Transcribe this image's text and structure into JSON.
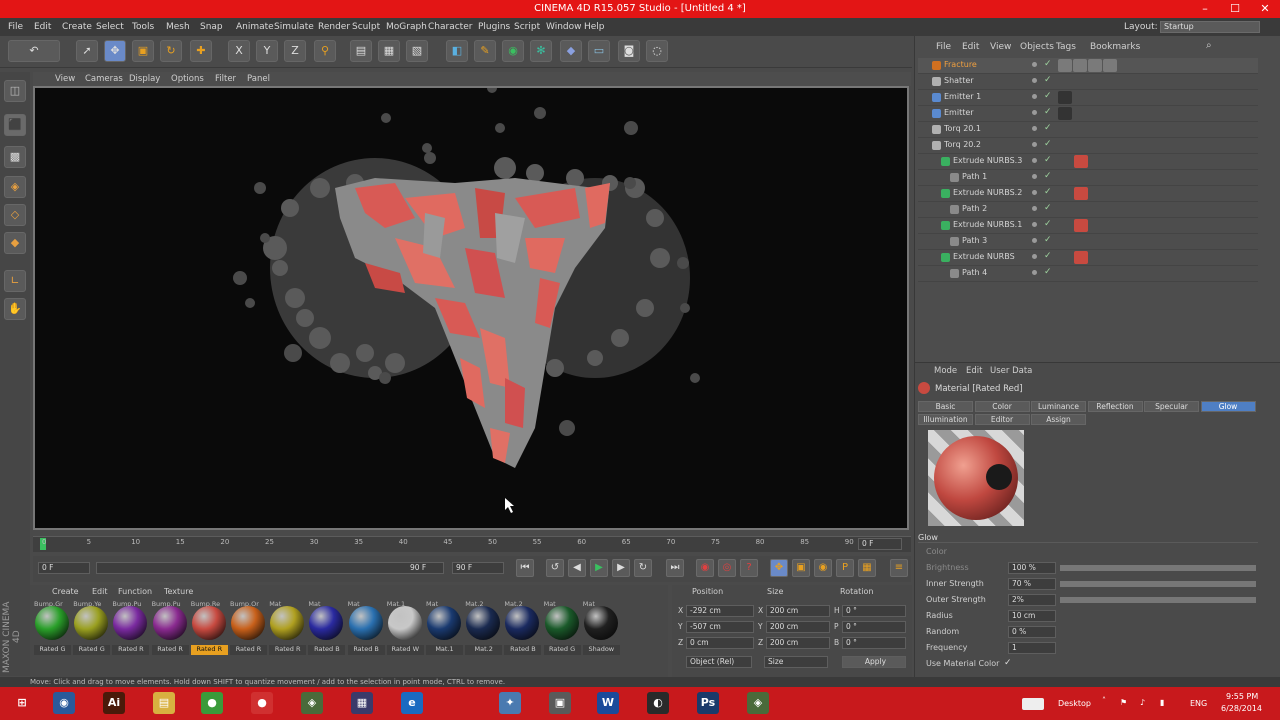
{
  "window": {
    "title": "CINEMA 4D R15.057 Studio - [Untitled 4 *]",
    "minimize_label": "–",
    "maximize_label": "☐",
    "close_label": "✕"
  },
  "menu": [
    "File",
    "Edit",
    "Create",
    "Select",
    "Tools",
    "Mesh",
    "Snap",
    "Animate",
    "Simulate",
    "Render",
    "Sculpt",
    "MoGraph",
    "Character",
    "Plugins",
    "Script",
    "Window",
    "Help"
  ],
  "layout": {
    "label": "Layout:",
    "value": "Startup"
  },
  "viewport": {
    "menu": [
      "View",
      "Cameras",
      "Display",
      "Options",
      "Filter",
      "Panel"
    ]
  },
  "timeline": {
    "ticks": [
      "0",
      "5",
      "10",
      "15",
      "20",
      "25",
      "30",
      "35",
      "40",
      "45",
      "50",
      "55",
      "60",
      "65",
      "70",
      "75",
      "80",
      "85",
      "90"
    ],
    "end_frame": "0 F",
    "start_field": "0 F",
    "range_end": "90 F",
    "max_field": "90 F"
  },
  "material_manager": {
    "menu": [
      "Create",
      "Edit",
      "Function",
      "Texture"
    ],
    "materials": [
      {
        "top": "Bump.Gr",
        "name": "Rated G",
        "color": "#2aa02a"
      },
      {
        "top": "Bump.Ye",
        "name": "Rated G",
        "color": "#9aa020"
      },
      {
        "top": "Bump.Pu",
        "name": "Rated R",
        "color": "#7a2aa0"
      },
      {
        "top": "Bump.Pu",
        "name": "Rated R",
        "color": "#8a2a90"
      },
      {
        "top": "Bump.Re",
        "name": "Rated R",
        "color": "#c84a40",
        "selected": true
      },
      {
        "top": "Bump.Or",
        "name": "Rated R",
        "color": "#c8601a"
      },
      {
        "top": "Mat",
        "name": "Rated R",
        "color": "#b0a020"
      },
      {
        "top": "Mat",
        "name": "Rated B",
        "color": "#2a2aa0"
      },
      {
        "top": "Mat",
        "name": "Rated B",
        "color": "#2a70b0"
      },
      {
        "top": "Mat.1",
        "name": "Rated W",
        "color": "#c8c8c8"
      },
      {
        "top": "Mat",
        "name": "Mat.1",
        "color": "#1a3a70"
      },
      {
        "top": "Mat.2",
        "name": "Mat.2",
        "color": "#1a2a50"
      },
      {
        "top": "Mat.2",
        "name": "Rated B",
        "color": "#1a2a60"
      },
      {
        "top": "Mat",
        "name": "Rated G",
        "color": "#1a5a2a"
      },
      {
        "top": "Mat",
        "name": "Shadow",
        "color": "#202020"
      }
    ],
    "brand": "MAXON CINEMA 4D"
  },
  "coordinates": {
    "headers": [
      "Position",
      "Size",
      "Rotation"
    ],
    "rows": [
      {
        "axis": "X",
        "pos": "-292 cm",
        "size_axis": "X",
        "size": "200 cm",
        "rot_axis": "H",
        "rot": "0 °"
      },
      {
        "axis": "Y",
        "pos": "-507 cm",
        "size_axis": "Y",
        "size": "200 cm",
        "rot_axis": "P",
        "rot": "0 °"
      },
      {
        "axis": "Z",
        "pos": "0 cm",
        "size_axis": "Z",
        "size": "200 cm",
        "rot_axis": "B",
        "rot": "0 °"
      }
    ],
    "mode": "Object (Rel)",
    "size_mode": "Size",
    "apply": "Apply"
  },
  "object_manager": {
    "menu": [
      "File",
      "Edit",
      "View",
      "Objects",
      "Tags",
      "Bookmarks"
    ],
    "objects": [
      {
        "name": "Fracture",
        "indent": 0,
        "color": "#d07020",
        "highlight": true
      },
      {
        "name": "Shatter",
        "indent": 0,
        "color": "#b0b0b0"
      },
      {
        "name": "Emitter 1",
        "indent": 0,
        "color": "#5a8ad0"
      },
      {
        "name": "Emitter",
        "indent": 0,
        "color": "#5a8ad0"
      },
      {
        "name": "Torq 20.1",
        "indent": 0,
        "color": "#b0b0b0"
      },
      {
        "name": "Torq 20.2",
        "indent": 0,
        "color": "#b0b0b0"
      },
      {
        "name": "Extrude NURBS.3",
        "indent": 1,
        "color": "#3ab060"
      },
      {
        "name": "Path 1",
        "indent": 2,
        "color": "#8a8a8a"
      },
      {
        "name": "Extrude NURBS.2",
        "indent": 1,
        "color": "#3ab060"
      },
      {
        "name": "Path 2",
        "indent": 2,
        "color": "#8a8a8a"
      },
      {
        "name": "Extrude NURBS.1",
        "indent": 1,
        "color": "#3ab060"
      },
      {
        "name": "Path 3",
        "indent": 2,
        "color": "#8a8a8a"
      },
      {
        "name": "Extrude NURBS",
        "indent": 1,
        "color": "#3ab060"
      },
      {
        "name": "Path 4",
        "indent": 2,
        "color": "#8a8a8a"
      }
    ]
  },
  "attributes": {
    "menu": [
      "Mode",
      "Edit",
      "User Data"
    ],
    "material_title": "Material [Rated Red]",
    "tabs_row1": [
      "Basic",
      "Color",
      "Luminance",
      "Reflection",
      "Specular",
      "Glow"
    ],
    "tabs_row2": [
      "Illumination",
      "Editor",
      "Assign"
    ],
    "active_tab": "Glow",
    "section": "Glow",
    "fields": [
      {
        "label": "Color",
        "value": ""
      },
      {
        "label": "Brightness",
        "value": "100 %"
      },
      {
        "label": "Inner Strength",
        "value": "70 %"
      },
      {
        "label": "Outer Strength",
        "value": "2%"
      },
      {
        "label": "Radius",
        "value": "10 cm"
      },
      {
        "label": "Random",
        "value": "0 %"
      },
      {
        "label": "Frequency",
        "value": "1"
      },
      {
        "label": "Use Material Color",
        "value": "✓"
      }
    ]
  },
  "status": "Move: Click and drag to move elements. Hold down SHIFT to quantize movement / add to the selection in point mode, CTRL to remove.",
  "taskbar": {
    "apps": [
      {
        "name": "windows-start",
        "glyph": "⊞",
        "color": "#c8191c"
      },
      {
        "name": "cinema4d",
        "glyph": "◉",
        "color": "#2a5a9a"
      },
      {
        "name": "illustrator",
        "glyph": "Ai",
        "color": "#4a1a0a"
      },
      {
        "name": "explorer",
        "glyph": "▤",
        "color": "#d8b040"
      },
      {
        "name": "chrome",
        "glyph": "●",
        "color": "#3a9a3a"
      },
      {
        "name": "record",
        "glyph": "●",
        "color": "#d03030"
      },
      {
        "name": "c4d-alt",
        "glyph": "◈",
        "color": "#4a6a3a"
      },
      {
        "name": "media",
        "glyph": "▦",
        "color": "#3a3a6a"
      },
      {
        "name": "ie",
        "glyph": "e",
        "color": "#1a6ac0"
      },
      {
        "name": "tools",
        "glyph": "✦",
        "color": "#4a7ab0"
      },
      {
        "name": "folder",
        "glyph": "▣",
        "color": "#5a5a5a"
      },
      {
        "name": "word",
        "glyph": "W",
        "color": "#1a4a9a"
      },
      {
        "name": "steam",
        "glyph": "◐",
        "color": "#2a2a2a"
      },
      {
        "name": "photoshop",
        "glyph": "Ps",
        "color": "#1a3a6a"
      },
      {
        "name": "c4d-2",
        "glyph": "◈",
        "color": "#4a6a3a"
      }
    ],
    "desktop_label": "Desktop",
    "language": "ENG",
    "time": "9:55 PM",
    "date": "6/28/2014"
  }
}
